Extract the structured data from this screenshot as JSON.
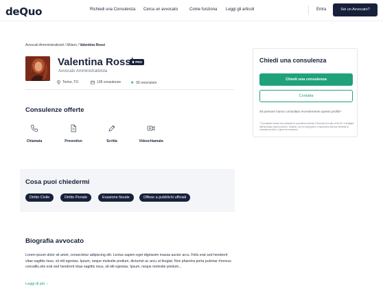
{
  "brand": {
    "logo": "deQuo",
    "accent": "#1fa27a",
    "dark": "#17213a"
  },
  "nav": {
    "links": [
      "Richiedi una Consulenza",
      "Cerca un avvocato",
      "Come funziona",
      "Leggi gli articoli"
    ],
    "login": "Entra",
    "lawyer_cta": "Sei un Avvocato?"
  },
  "breadcrumb": {
    "trail": "Avvocati Amministrativisti / Milano / ",
    "current": "Valentina Rossi"
  },
  "profile": {
    "name": "Valentina Rossi",
    "badge": "PRO",
    "role": "Avvocato Amministrativista",
    "location": "Torino, TO",
    "consultations": "128 consulenze",
    "reviews": "55 recensioni",
    "icons": {
      "location": "location-pin-icon",
      "consultations": "calendar-icon",
      "reviews": "star-icon",
      "badge": "crown-icon"
    }
  },
  "offers": {
    "title": "Consulenze offerte",
    "items": [
      {
        "label": "Chiamata",
        "icon": "phone-icon"
      },
      {
        "label": "Preventivo",
        "icon": "document-icon"
      },
      {
        "label": "Scritta",
        "icon": "pencil-icon"
      },
      {
        "label": "Videochiamata",
        "icon": "video-camera-icon"
      }
    ]
  },
  "ask": {
    "title": "Cosa puoi chiedermi",
    "tags": [
      "Diritto Civile",
      "Diritto Penale",
      "Evasione fiscale",
      "Offese a pubblichi ufficiali"
    ]
  },
  "bio": {
    "title": "Biografia avvocato",
    "text": "Lorem ipsum dolor sit amet, consectetur adipiscing elit. Lectus sapien eget dignissim massa auctor arcu. Felis erat sed hendrerit vitae sagittis risus, sit elit egestas. Ipsum, neque molestie pretium, dictumst ac arcu ut feugiat. Non pharetra porta pulvinar rhoncus convallis.elis erat sed hendrerit vitae sagittis risus, sit elit egestas. Ipsum, neque molestie pretium...",
    "read_more": "Leggi di più",
    "read_more_icon": "chevron-right-icon"
  },
  "sidebar": {
    "title": "Chiedi una consulenza",
    "primary": "Chiedi una consulenza",
    "secondary": "Contatta",
    "note": "49 persone hanno consultato recentemente questo profilo*",
    "small_print": "* È possibile inviare una richiesta di consulenza diretta. Preventivi al costo di €0,50. Il dettaglio dell'avvocato potrà riceverlo. Tuttavia, non mi impegnerò a rispondere alla tua richiesta di consulenza entro 4 giorni se avessero."
  }
}
